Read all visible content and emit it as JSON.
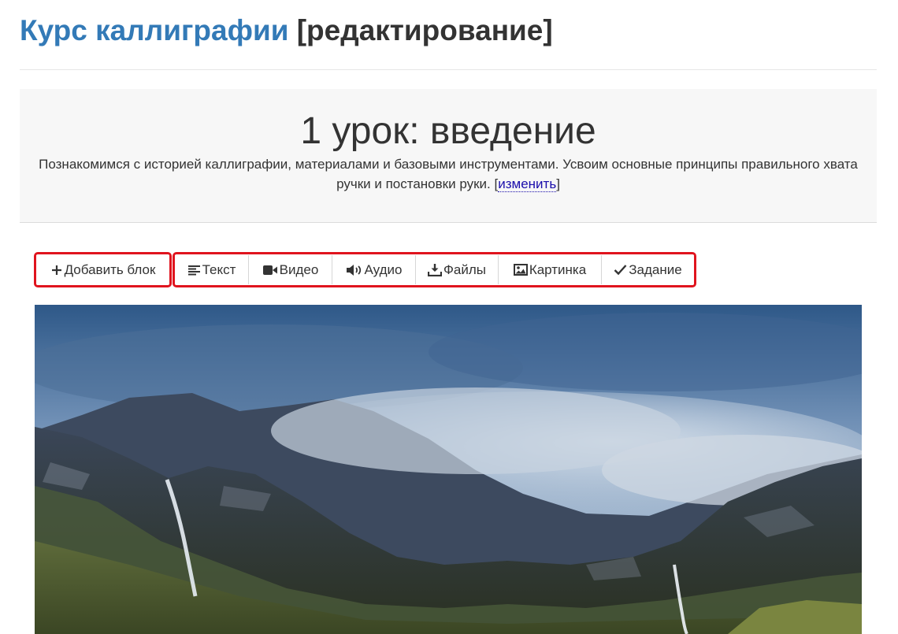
{
  "header": {
    "course_title": "Курс каллиграфии",
    "mode_label": "[редактирование]"
  },
  "lesson": {
    "title": "1 урок: введение",
    "description": "Познакомимся с историей каллиграфии, материалами и базовыми инструментами. Усвоим основные принципы правильного хвата ручки и постановки руки.",
    "edit_open": "[",
    "edit_link": "изменить",
    "edit_close": "]"
  },
  "toolbar": {
    "add_block": {
      "label": "Добавить блок",
      "icon": "plus-icon"
    },
    "block_types": [
      {
        "label": "Текст",
        "icon": "align-left-icon"
      },
      {
        "label": "Видео",
        "icon": "video-camera-icon"
      },
      {
        "label": "Аудио",
        "icon": "speaker-icon"
      },
      {
        "label": "Файлы",
        "icon": "download-icon"
      },
      {
        "label": "Картинка",
        "icon": "image-icon"
      },
      {
        "label": "Задание",
        "icon": "checkmark-icon"
      }
    ]
  },
  "content": {
    "image_subject": "misty mountain landscape with waterfall"
  },
  "colors": {
    "link_blue": "#337ab7",
    "highlight_red": "#e0141e",
    "panel_bg": "#f7f7f7"
  }
}
